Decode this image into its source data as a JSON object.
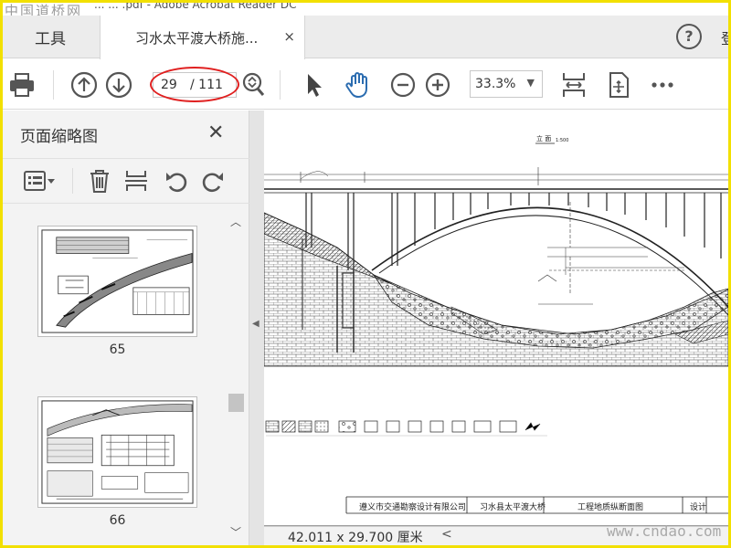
{
  "watermark_top": "中国道桥网",
  "window_title_fragment": "...   ...   .pdf - Adobe Acrobat Reader DC",
  "tabs": {
    "tools_label": "工具",
    "document_label": "习水太平渡大桥施...",
    "close_glyph": "×"
  },
  "header": {
    "help_glyph": "?",
    "signin_fragment": "登"
  },
  "toolbar": {
    "current_page": "29",
    "total_pages": "/ 111",
    "zoom": "33.3%"
  },
  "sidebar": {
    "title": "页面缩略图",
    "close_glyph": "✕",
    "thumbnails": [
      {
        "label": "65"
      },
      {
        "label": "66"
      }
    ]
  },
  "drawing": {
    "section_title": "立 面",
    "scale": "1:500",
    "title_block": {
      "company": "遵义市交通勘察设计有限公司",
      "project": "习水县太平渡大桥",
      "sheet": "工程地质纵断面图",
      "design": "设计"
    }
  },
  "status": {
    "page_size": "42.011 x 29.700 厘米",
    "scroll_left": "<"
  },
  "watermark_bottom": "www.cndao.com",
  "colors": {
    "accent": "#2b6cb0",
    "highlight_ellipse": "#e02020",
    "frame": "#f2e000"
  }
}
